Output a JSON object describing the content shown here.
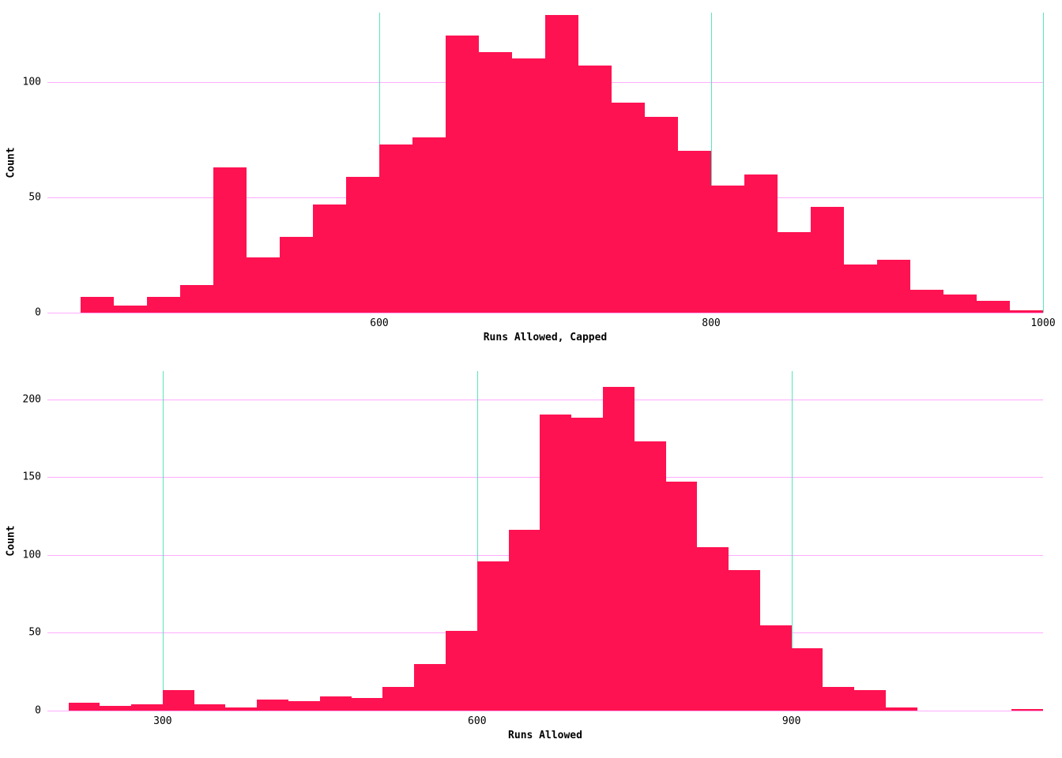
{
  "chart_data": [
    {
      "type": "bar",
      "bin_width": 20,
      "categories": [
        420,
        440,
        460,
        480,
        500,
        520,
        540,
        560,
        580,
        600,
        620,
        640,
        660,
        680,
        700,
        720,
        740,
        760,
        780,
        800,
        820,
        840,
        860,
        880,
        900,
        920,
        940,
        960,
        980
      ],
      "values": [
        7,
        3,
        7,
        12,
        63,
        24,
        33,
        47,
        59,
        73,
        76,
        120,
        113,
        110,
        129,
        107,
        91,
        85,
        70,
        55,
        60,
        35,
        46,
        21,
        23,
        10,
        8,
        5,
        1
      ],
      "title": "",
      "xlabel": "Runs Allowed, Capped",
      "ylabel": "Count",
      "xlim": [
        400,
        1000
      ],
      "ylim": [
        0,
        130
      ],
      "xticks": [
        600,
        800,
        1000
      ],
      "yticks": [
        0,
        50,
        100
      ]
    },
    {
      "type": "bar",
      "bin_width": 30,
      "categories": [
        210,
        240,
        270,
        300,
        330,
        360,
        390,
        420,
        450,
        480,
        510,
        540,
        570,
        600,
        630,
        660,
        690,
        720,
        750,
        780,
        810,
        840,
        870,
        900,
        930,
        960,
        990,
        1110
      ],
      "values": [
        5,
        3,
        4,
        13,
        4,
        2,
        7,
        6,
        9,
        8,
        15,
        30,
        51,
        96,
        116,
        190,
        188,
        208,
        173,
        147,
        105,
        90,
        55,
        40,
        15,
        13,
        2,
        1
      ],
      "title": "",
      "xlabel": "Runs Allowed",
      "ylabel": "Count",
      "xlim": [
        190,
        1140
      ],
      "ylim": [
        0,
        218
      ],
      "xticks": [
        300,
        600,
        900
      ],
      "yticks": [
        0,
        50,
        100,
        150,
        200
      ]
    }
  ],
  "labels": {
    "top": {
      "ylabel": "Count",
      "xlabel": "Runs Allowed, Capped"
    },
    "bottom": {
      "ylabel": "Count",
      "xlabel": "Runs Allowed"
    },
    "xticks_top": {
      "t600": "600",
      "t800": "800",
      "t1000": "1000"
    },
    "yticks_top": {
      "t0": "0",
      "t50": "50",
      "t100": "100"
    },
    "xticks_bottom": {
      "t300": "300",
      "t600": "600",
      "t900": "900"
    },
    "yticks_bottom": {
      "t0": "0",
      "t50": "50",
      "t100": "100",
      "t150": "150",
      "t200": "200"
    }
  }
}
